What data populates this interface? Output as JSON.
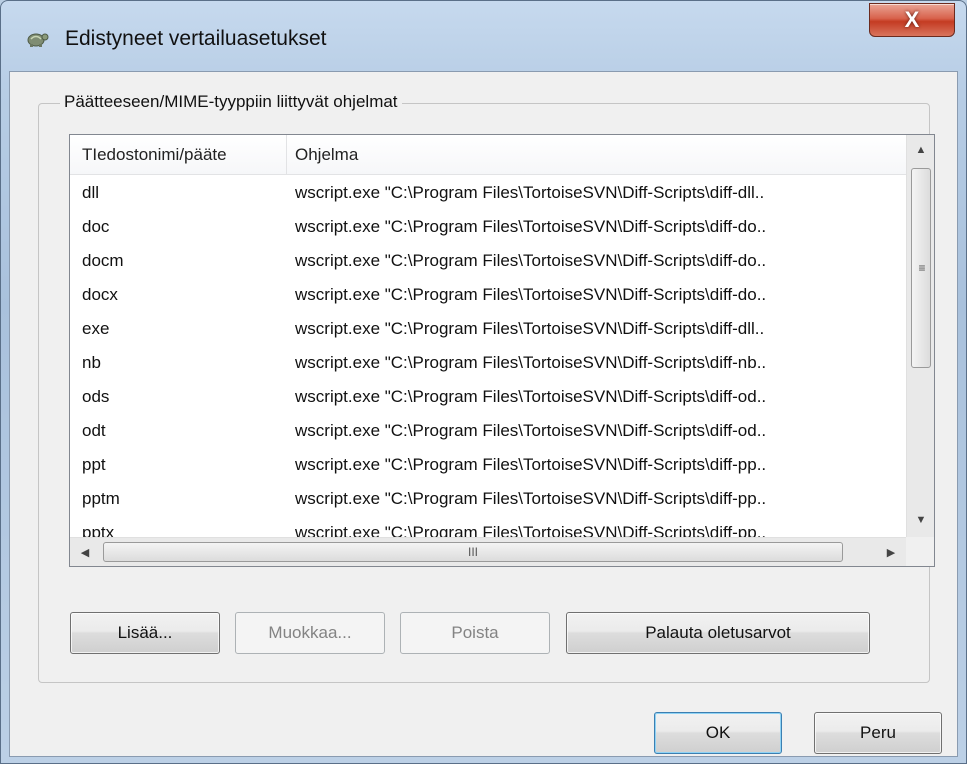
{
  "window": {
    "title": "Edistyneet vertailuasetukset",
    "close_label": "X",
    "icon": "tortoise-icon"
  },
  "group": {
    "label": "Päätteeseen/MIME-tyyppiin liittyvät ohjelmat"
  },
  "list": {
    "columns": [
      "TIedostonimi/pääte",
      "Ohjelma"
    ],
    "rows": [
      {
        "ext": "dll",
        "program": "wscript.exe \"C:\\Program Files\\TortoiseSVN\\Diff-Scripts\\diff-dll.."
      },
      {
        "ext": "doc",
        "program": "wscript.exe \"C:\\Program Files\\TortoiseSVN\\Diff-Scripts\\diff-do.."
      },
      {
        "ext": "docm",
        "program": "wscript.exe \"C:\\Program Files\\TortoiseSVN\\Diff-Scripts\\diff-do.."
      },
      {
        "ext": "docx",
        "program": "wscript.exe \"C:\\Program Files\\TortoiseSVN\\Diff-Scripts\\diff-do.."
      },
      {
        "ext": "exe",
        "program": "wscript.exe \"C:\\Program Files\\TortoiseSVN\\Diff-Scripts\\diff-dll.."
      },
      {
        "ext": "nb",
        "program": "wscript.exe \"C:\\Program Files\\TortoiseSVN\\Diff-Scripts\\diff-nb.."
      },
      {
        "ext": "ods",
        "program": "wscript.exe \"C:\\Program Files\\TortoiseSVN\\Diff-Scripts\\diff-od.."
      },
      {
        "ext": "odt",
        "program": "wscript.exe \"C:\\Program Files\\TortoiseSVN\\Diff-Scripts\\diff-od.."
      },
      {
        "ext": "ppt",
        "program": "wscript.exe \"C:\\Program Files\\TortoiseSVN\\Diff-Scripts\\diff-pp.."
      },
      {
        "ext": "pptm",
        "program": "wscript.exe \"C:\\Program Files\\TortoiseSVN\\Diff-Scripts\\diff-pp.."
      },
      {
        "ext": "pptx",
        "program": "wscript.exe \"C:\\Program Files\\TortoiseSVN\\Diff-Scripts\\diff-pp.."
      }
    ],
    "scroll_thumb_grip": "≡",
    "hscroll_thumb_grip": "III"
  },
  "buttons": {
    "add": "Lisää...",
    "edit": "Muokkaa...",
    "remove": "Poista",
    "restore": "Palauta oletusarvot",
    "ok": "OK",
    "cancel": "Peru"
  }
}
